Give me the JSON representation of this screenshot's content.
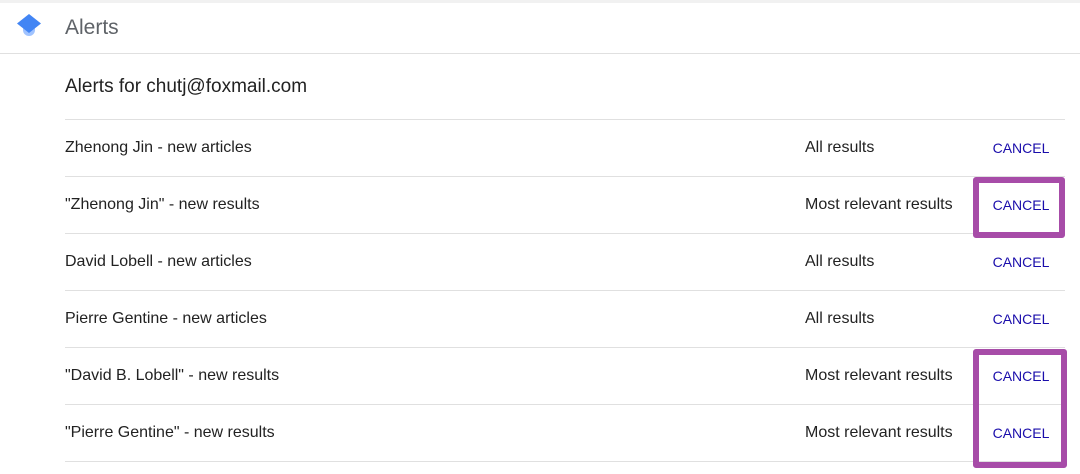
{
  "header": {
    "title": "Alerts",
    "logo_icon": "scholar-cap-icon",
    "logo_colors": {
      "top": "#4285f4",
      "bottom": "#a0c3ff"
    }
  },
  "account": {
    "heading": "Alerts for chutj@foxmail.com"
  },
  "alerts": [
    {
      "query": "Zhenong Jin - new articles",
      "type": "All results",
      "action": "CANCEL",
      "highlighted": false
    },
    {
      "query": "\"Zhenong Jin\" - new results",
      "type": "Most relevant results",
      "action": "CANCEL",
      "highlighted": true
    },
    {
      "query": "David Lobell - new articles",
      "type": "All results",
      "action": "CANCEL",
      "highlighted": false
    },
    {
      "query": "Pierre Gentine - new articles",
      "type": "All results",
      "action": "CANCEL",
      "highlighted": false
    },
    {
      "query": "\"David B. Lobell\" - new results",
      "type": "Most relevant results",
      "action": "CANCEL",
      "highlighted": true
    },
    {
      "query": "\"Pierre Gentine\" - new results",
      "type": "Most relevant results",
      "action": "CANCEL",
      "highlighted": true
    }
  ],
  "colors": {
    "link": "#1a0dab",
    "highlight": "#a74ca8",
    "divider": "#e0e0e0",
    "title_gray": "#5f6368"
  }
}
